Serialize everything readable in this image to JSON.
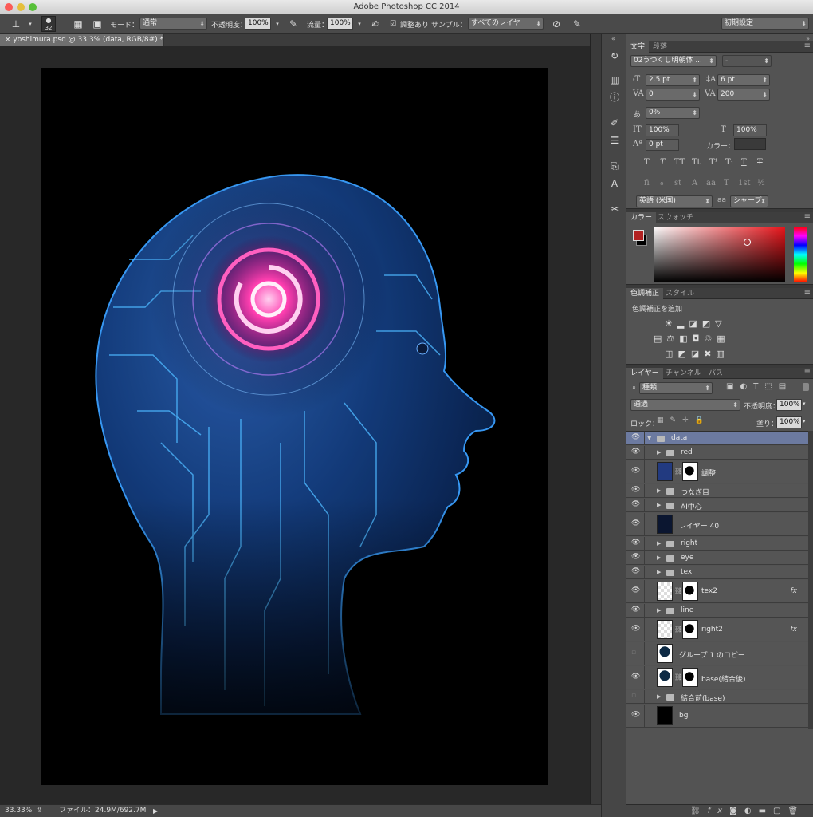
{
  "window": {
    "title": "Adobe Photoshop CC 2014"
  },
  "options": {
    "brush_size": "32",
    "mode_label": "モード：",
    "mode_value": "通常",
    "opacity_label": "不透明度：",
    "opacity_value": "100%",
    "flow_label": "流量：",
    "flow_value": "100%",
    "aligned_label": "調整あり",
    "sample_label": "サンプル：",
    "sample_value": "すべてのレイヤー",
    "workspace": "初期設定"
  },
  "document": {
    "tab_title": "yoshimura.psd @ 33.3% (data, RGB/8#) *"
  },
  "status": {
    "zoom": "33.33%",
    "file_info": "ファイル：24.9M/692.7M"
  },
  "character_panel": {
    "tabs": [
      "文字",
      "段落"
    ],
    "font_family": "02うつくし明朝体 ...",
    "font_style": "-",
    "font_size": "2.5 pt",
    "leading": "6 pt",
    "kerning": "0",
    "tracking": "200",
    "tsume": "0%",
    "vertical_scale": "100%",
    "horizontal_scale": "100%",
    "baseline_shift": "0 pt",
    "color_label": "カラー：",
    "style_buttons": [
      "T",
      "T",
      "TT",
      "Tt",
      "T¹",
      "T₁",
      "T",
      "T"
    ],
    "opentype_buttons": [
      "fi",
      "ℴ",
      "st",
      "A",
      "aa",
      "T",
      "1st",
      "½"
    ],
    "language": "英語 (米国)",
    "aa_icon": "aa",
    "antialias": "シャープ"
  },
  "color_panel": {
    "tabs": [
      "カラー",
      "スウォッチ"
    ],
    "foreground": "#b22222",
    "background": "#000000"
  },
  "adjustments_panel": {
    "tabs": [
      "色調補正",
      "スタイル"
    ],
    "add_label": "色調補正を追加"
  },
  "layers_panel": {
    "tabs": [
      "レイヤー",
      "チャンネル",
      "パス"
    ],
    "filter_kind": "種類",
    "blend_mode": "通過",
    "opacity_label": "不透明度：",
    "opacity_value": "100%",
    "lock_label": "ロック：",
    "fill_label": "塗り：",
    "fill_value": "100%",
    "layers": [
      {
        "name": "data",
        "type": "group",
        "open": true,
        "selected": true,
        "visible": true
      },
      {
        "name": "red",
        "type": "group",
        "visible": true
      },
      {
        "name": "調整",
        "type": "masked",
        "visible": true
      },
      {
        "name": "つなぎ目",
        "type": "group",
        "visible": true
      },
      {
        "name": "AI中心",
        "type": "group",
        "visible": true
      },
      {
        "name": "レイヤー 40",
        "type": "pixel",
        "visible": true
      },
      {
        "name": "right",
        "type": "group",
        "visible": true
      },
      {
        "name": "eye",
        "type": "group",
        "visible": true
      },
      {
        "name": "tex",
        "type": "group",
        "visible": true
      },
      {
        "name": "tex2",
        "type": "masked",
        "fx": true,
        "visible": true
      },
      {
        "name": "line",
        "type": "group",
        "visible": true
      },
      {
        "name": "right2",
        "type": "masked",
        "fx": true,
        "visible": true
      },
      {
        "name": "グループ 1 のコピー",
        "type": "pixel",
        "visible": false
      },
      {
        "name": "base(結合後)",
        "type": "masked",
        "visible": true
      },
      {
        "name": "結合前(base)",
        "type": "group",
        "visible": false
      },
      {
        "name": "bg",
        "type": "pixel",
        "visible": true
      }
    ],
    "footer_icons": [
      "link-icon",
      "fx-icon",
      "mask-icon",
      "adjustment-icon",
      "group-icon",
      "new-layer-icon",
      "trash-icon"
    ]
  },
  "colors": {
    "accent_selected": "#6c7aa0",
    "circuit_blue": "#2f86e0",
    "glow_pink": "#ff2fa0"
  }
}
